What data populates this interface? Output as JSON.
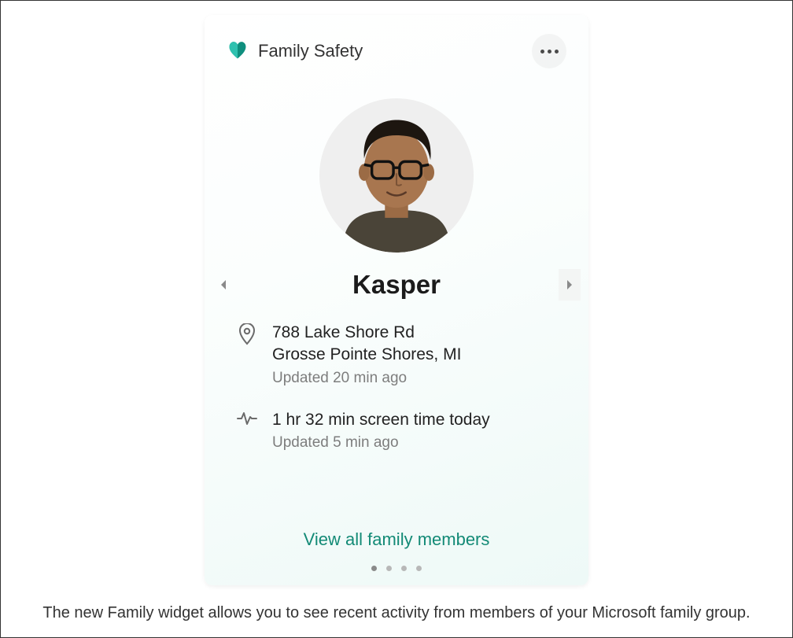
{
  "widget": {
    "title": "Family Safety",
    "member": {
      "name": "Kasper",
      "location": {
        "line1": "788 Lake Shore Rd",
        "line2": "Grosse Pointe Shores, MI",
        "updated": "Updated 20 min ago"
      },
      "screen_time": {
        "value": "1 hr 32 min screen time today",
        "updated": "Updated 5 min ago"
      }
    },
    "view_all_label": "View all family members",
    "page_dots": 4,
    "active_dot": 0
  },
  "caption": "The new Family widget allows you to see recent activity from members of your Microsoft family group.",
  "colors": {
    "accent": "#138a76",
    "heart_a": "#0f8f7e",
    "heart_b": "#2fc1af"
  }
}
